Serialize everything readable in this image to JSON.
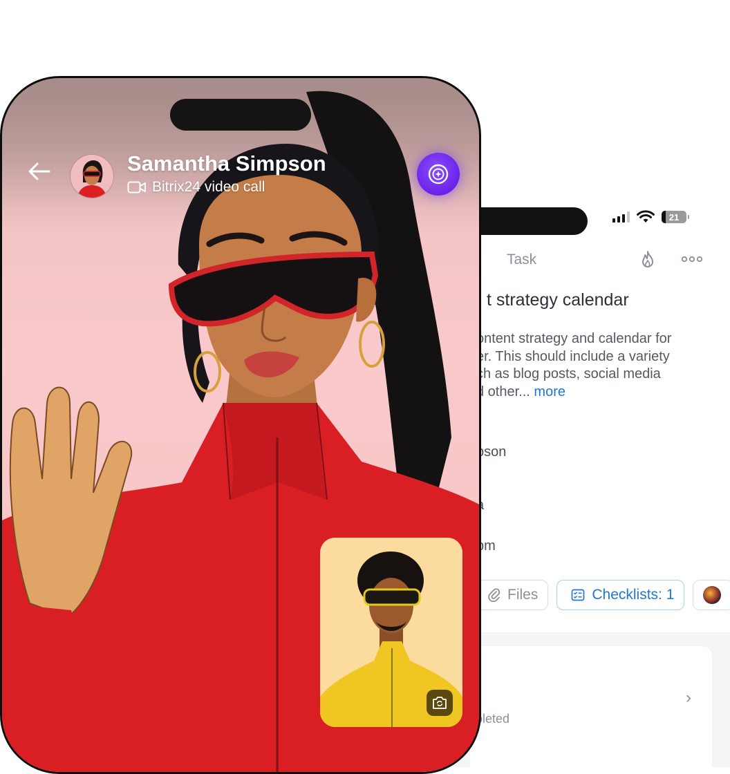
{
  "task_screen": {
    "status_bar": {
      "battery": "21"
    },
    "header": {
      "title": "Task"
    },
    "title": "t strategy calendar",
    "description": {
      "lines": [
        "ontent strategy and calendar for",
        "er. This should include a variety",
        "ch as blog posts, social media",
        "d other..."
      ],
      "more_link": "more"
    },
    "rows": [
      "pson",
      "a",
      "pm"
    ],
    "chips": {
      "files": "Files",
      "checklists": "Checklists: 1"
    },
    "card": {
      "status": "pleted"
    }
  },
  "call_screen": {
    "caller_name": "Samantha Simpson",
    "call_type": "Bitrix24 video call"
  },
  "colors": {
    "accent_blue": "#1f77d4",
    "ai_purple": "#6a22e8",
    "call_background": "#f9c9cb",
    "jacket_red": "#d91f24"
  },
  "icons": [
    "back-arrow-icon",
    "video-camera-icon",
    "ai-assistant-icon",
    "camera-switch-icon",
    "fire-icon",
    "more-options-icon",
    "paperclip-icon",
    "checklist-icon",
    "chevron-right-icon",
    "wifi-icon",
    "signal-icon",
    "battery-icon"
  ]
}
